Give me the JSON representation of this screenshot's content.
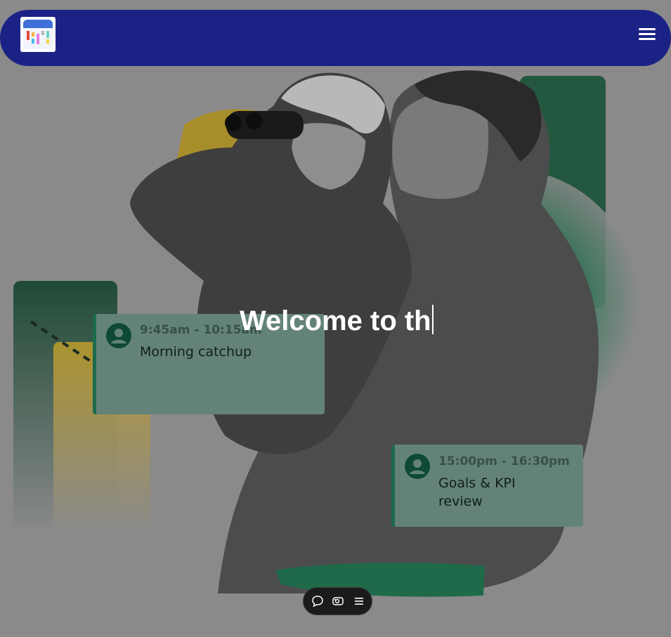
{
  "header": {
    "logo_icon": "calendar-app-logo",
    "menu_icon": "hamburger-menu-icon"
  },
  "hero": {
    "headline": "Welcome to th",
    "image_description_icon": "father-and-child-with-binoculars-photo"
  },
  "events": [
    {
      "time": "9:45am - 10:15am",
      "title": "Morning catchup",
      "icon": "user-avatar-icon"
    },
    {
      "time": "15:00pm - 16:30pm",
      "title_line1": "Goals & KPI",
      "title_line2": "review",
      "icon": "user-avatar-icon"
    }
  ],
  "toolbar": {
    "items": [
      {
        "icon": "chat-bubble-icon"
      },
      {
        "icon": "camera-toggle-icon"
      },
      {
        "icon": "list-menu-icon"
      }
    ]
  },
  "colors": {
    "header_bg": "#1b2286",
    "card_bg": "#648378",
    "card_accent": "#1c6b4c",
    "toolbar_bg": "#1b1b1b"
  }
}
